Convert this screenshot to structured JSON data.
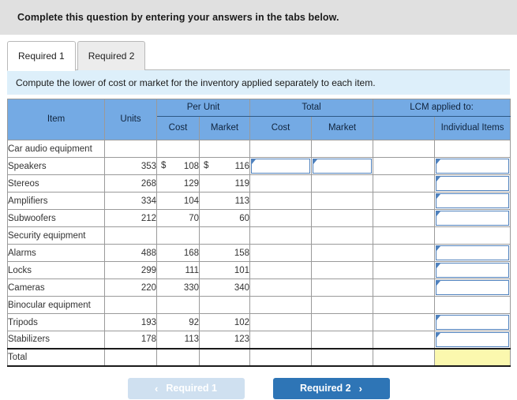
{
  "banner": {
    "text": "Complete this question by entering your answers in the tabs below."
  },
  "tabs": [
    {
      "label": "Required 1",
      "active": true
    },
    {
      "label": "Required 2",
      "active": false
    }
  ],
  "sub_instruction": {
    "text": "Compute the lower of cost or market for the inventory applied separately to each item."
  },
  "table": {
    "headers": {
      "item": "Item",
      "units": "Units",
      "per_unit": "Per Unit",
      "total": "Total",
      "lcm": "LCM applied to:",
      "per_unit_cost": "Cost",
      "per_unit_market": "Market",
      "total_cost": "Cost",
      "total_market": "Market",
      "lcm_blank": "",
      "lcm_individual": "Individual Items"
    },
    "rows": [
      {
        "type": "category",
        "item": "Car audio equipment",
        "units": "",
        "cost": "",
        "market": "",
        "cost_symbol": "",
        "market_symbol": ""
      },
      {
        "type": "item",
        "item": "Speakers",
        "units": "353",
        "cost": "108",
        "market": "116",
        "cost_symbol": "$",
        "market_symbol": "$",
        "total_cost_input": true,
        "total_market_input": true,
        "individual_input": true
      },
      {
        "type": "item",
        "item": "Stereos",
        "units": "268",
        "cost": "129",
        "market": "119",
        "cost_symbol": "",
        "market_symbol": "",
        "total_cost_input": false,
        "total_market_input": false,
        "individual_input": true
      },
      {
        "type": "item",
        "item": "Amplifiers",
        "units": "334",
        "cost": "104",
        "market": "113",
        "cost_symbol": "",
        "market_symbol": "",
        "total_cost_input": false,
        "total_market_input": false,
        "individual_input": true
      },
      {
        "type": "item",
        "item": "Subwoofers",
        "units": "212",
        "cost": "70",
        "market": "60",
        "cost_symbol": "",
        "market_symbol": "",
        "total_cost_input": false,
        "total_market_input": false,
        "individual_input": true
      },
      {
        "type": "category",
        "item": "Security equipment",
        "units": "",
        "cost": "",
        "market": "",
        "cost_symbol": "",
        "market_symbol": ""
      },
      {
        "type": "item",
        "item": "Alarms",
        "units": "488",
        "cost": "168",
        "market": "158",
        "cost_symbol": "",
        "market_symbol": "",
        "total_cost_input": false,
        "total_market_input": false,
        "individual_input": true
      },
      {
        "type": "item",
        "item": "Locks",
        "units": "299",
        "cost": "111",
        "market": "101",
        "cost_symbol": "",
        "market_symbol": "",
        "total_cost_input": false,
        "total_market_input": false,
        "individual_input": true
      },
      {
        "type": "item",
        "item": "Cameras",
        "units": "220",
        "cost": "330",
        "market": "340",
        "cost_symbol": "",
        "market_symbol": "",
        "total_cost_input": false,
        "total_market_input": false,
        "individual_input": true
      },
      {
        "type": "category",
        "item": "Binocular equipment",
        "units": "",
        "cost": "",
        "market": "",
        "cost_symbol": "",
        "market_symbol": ""
      },
      {
        "type": "item",
        "item": "Tripods",
        "units": "193",
        "cost": "92",
        "market": "102",
        "cost_symbol": "",
        "market_symbol": "",
        "total_cost_input": false,
        "total_market_input": false,
        "individual_input": true
      },
      {
        "type": "item",
        "item": "Stabilizers",
        "units": "178",
        "cost": "113",
        "market": "123",
        "cost_symbol": "",
        "market_symbol": "",
        "total_cost_input": false,
        "total_market_input": false,
        "individual_input": true
      },
      {
        "type": "total",
        "item": "Total",
        "units": "",
        "cost": "",
        "market": "",
        "cost_symbol": "",
        "market_symbol": "",
        "total_cost_input": false,
        "total_market_input": false,
        "individual_input": false,
        "individual_yellow": true
      }
    ]
  },
  "footer": {
    "prev_label": "Required 1",
    "prev_chevron": "‹",
    "next_label": "Required 2",
    "next_chevron": "›"
  },
  "colors": {
    "banner_bg": "#e0e0e0",
    "sub_instruction_bg": "#ddeffa",
    "header_blue": "#74aae4",
    "input_border": "#4f81bd",
    "yellow_cell": "#fbf8ae",
    "next_button": "#2e75b6",
    "prev_button": "#cfe0f0"
  }
}
